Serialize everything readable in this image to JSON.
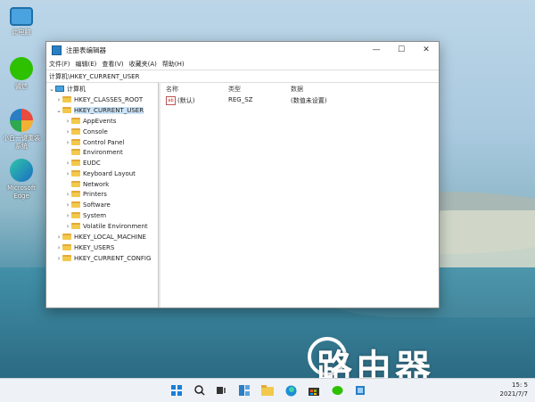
{
  "desktop": {
    "icons": [
      {
        "label": "此电脑",
        "icon": "computer-icon"
      },
      {
        "label": "微信",
        "icon": "wechat-icon"
      },
      {
        "label": "小白一键重装系统",
        "icon": "installer-icon"
      },
      {
        "label": "Microsoft Edge",
        "icon": "edge-icon"
      }
    ]
  },
  "window": {
    "title": "注册表编辑器",
    "controls": {
      "minimize": "—",
      "maximize": "☐",
      "close": "✕"
    },
    "menu": [
      "文件(F)",
      "编辑(E)",
      "查看(V)",
      "收藏夹(A)",
      "帮助(H)"
    ],
    "address": "计算机\\HKEY_CURRENT_USER"
  },
  "tree": {
    "root": "计算机",
    "hkcr": "HKEY_CLASSES_ROOT",
    "hkcu": "HKEY_CURRENT_USER",
    "hkcu_children": [
      "AppEvents",
      "Console",
      "Control Panel",
      "Environment",
      "EUDC",
      "Keyboard Layout",
      "Network",
      "Printers",
      "Software",
      "System",
      "Volatile Environment"
    ],
    "hklm": "HKEY_LOCAL_MACHINE",
    "hku": "HKEY_USERS",
    "hkcc": "HKEY_CURRENT_CONFIG"
  },
  "list": {
    "columns": [
      "名称",
      "类型",
      "数据"
    ],
    "rows": [
      {
        "name": "(默认)",
        "type": "REG_SZ",
        "data": "(数值未设置)",
        "icon": "ab"
      }
    ]
  },
  "taskbar": {
    "icons": [
      "start-icon",
      "search-icon",
      "task-view-icon",
      "widgets-icon",
      "file-explorer-icon",
      "edge-icon",
      "store-icon",
      "wechat-icon",
      "regedit-icon"
    ],
    "time": "15: 5",
    "date": "2021/7/7"
  },
  "watermark": "路由器"
}
